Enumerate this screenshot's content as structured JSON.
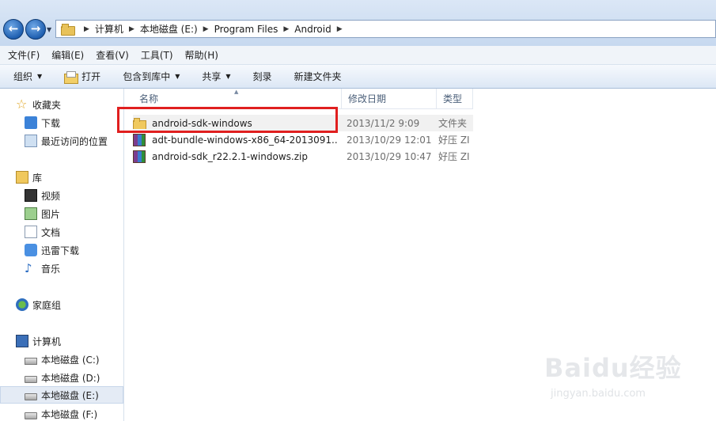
{
  "address": {
    "segments": [
      "计算机",
      "本地磁盘 (E:)",
      "Program Files",
      "Android"
    ]
  },
  "menu": [
    "文件(F)",
    "编辑(E)",
    "查看(V)",
    "工具(T)",
    "帮助(H)"
  ],
  "toolbar": {
    "organize": "组织",
    "open": "打开",
    "include": "包含到库中",
    "share": "共享",
    "burn": "刻录",
    "new_folder": "新建文件夹"
  },
  "nav": {
    "favorites": "收藏夹",
    "downloads": "下载",
    "recent": "最近访问的位置",
    "library": "库",
    "videos": "视频",
    "pictures": "图片",
    "documents": "文档",
    "xunlei": "迅雷下载",
    "music": "音乐",
    "homegroup": "家庭组",
    "computer": "计算机",
    "drive_c": "本地磁盘 (C:)",
    "drive_d": "本地磁盘 (D:)",
    "drive_e": "本地磁盘 (E:)",
    "drive_f": "本地磁盘 (F:)"
  },
  "columns": {
    "name": "名称",
    "date": "修改日期",
    "type": "类型"
  },
  "files": [
    {
      "name": "android-sdk-windows",
      "date": "2013/11/2 9:09",
      "type": "文件夹"
    },
    {
      "name": "adt-bundle-windows-x86_64-2013091...",
      "date": "2013/10/29 12:01",
      "type": "好压 ZI"
    },
    {
      "name": "android-sdk_r22.2.1-windows.zip",
      "date": "2013/10/29 10:47",
      "type": "好压 ZI"
    }
  ],
  "watermark": {
    "logo": "Baidu经验",
    "url": "jingyan.baidu.com"
  }
}
